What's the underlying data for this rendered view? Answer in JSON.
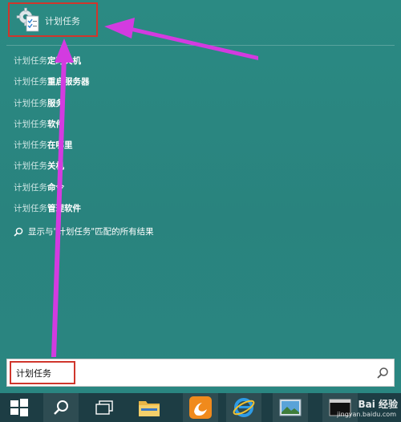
{
  "best_match": {
    "label": "计划任务",
    "icon": "task-scheduler-icon"
  },
  "suggestions": [
    {
      "query": "计划任务",
      "rest": "定时关机"
    },
    {
      "query": "计划任务",
      "rest": "重启服务器"
    },
    {
      "query": "计划任务",
      "rest": "服务"
    },
    {
      "query": "计划任务",
      "rest": "软件"
    },
    {
      "query": "计划任务",
      "rest": "在哪里"
    },
    {
      "query": "计划任务",
      "rest": "关机"
    },
    {
      "query": "计划任务",
      "rest": "命令"
    },
    {
      "query": "计划任务",
      "rest": "管理软件"
    }
  ],
  "search_all": {
    "label": "显示与\"计划任务\"匹配的所有结果",
    "icon": "search-icon"
  },
  "search_box": {
    "value": "计划任务",
    "submit_icon": "search-icon"
  },
  "taskbar": {
    "items": [
      {
        "name": "start-button",
        "icon": "windows-logo-icon"
      },
      {
        "name": "search-button",
        "icon": "search-icon"
      },
      {
        "name": "task-view-button",
        "icon": "task-view-icon"
      },
      {
        "name": "file-explorer-button",
        "icon": "folder-icon"
      },
      {
        "name": "uc-browser-button",
        "icon": "uc-browser-icon"
      },
      {
        "name": "internet-explorer-button",
        "icon": "internet-explorer-icon"
      },
      {
        "name": "photos-button",
        "icon": "photos-icon"
      },
      {
        "name": "command-prompt-button",
        "icon": "command-prompt-icon"
      }
    ]
  },
  "watermark": {
    "brand": "Bai 经验",
    "url": "jingyan.baidu.com"
  },
  "colors": {
    "background": "#2a8580",
    "highlight_border": "#d0362c",
    "annotation_arrow": "#d33be0",
    "taskbar": "#1d3d44"
  }
}
